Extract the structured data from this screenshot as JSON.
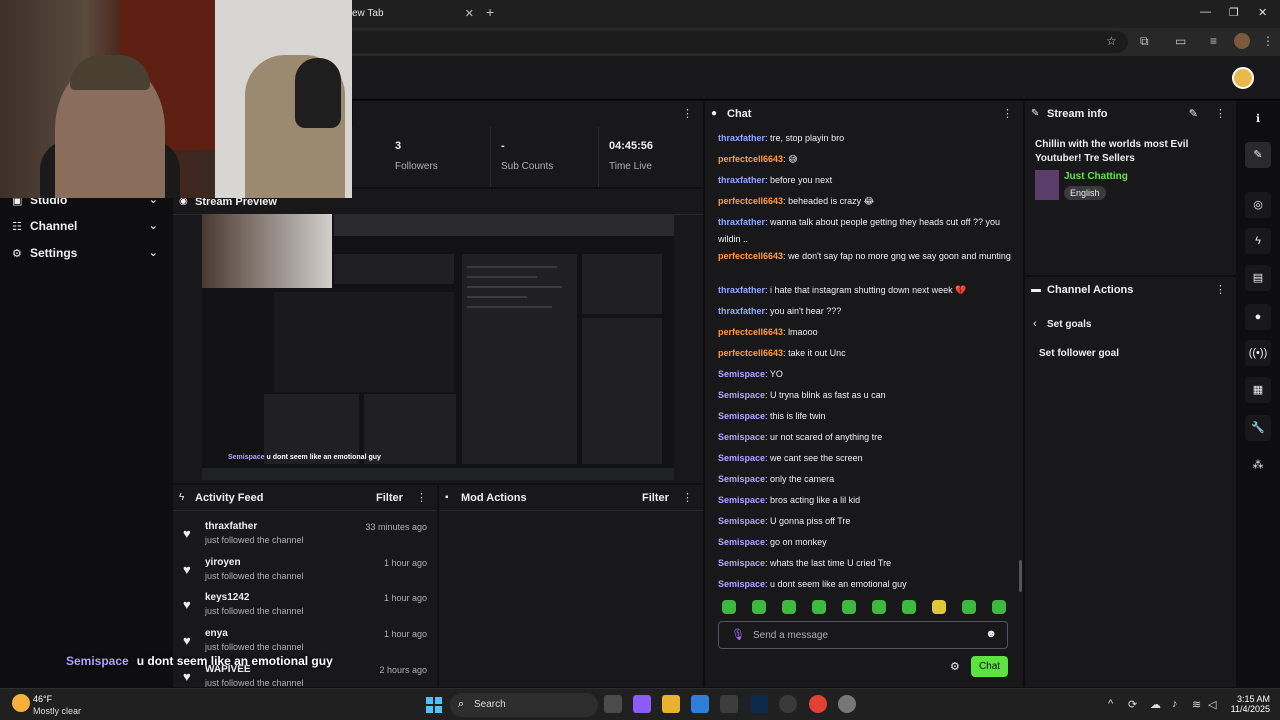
{
  "browser": {
    "tab_title": "ew Tab",
    "new_tab_symbol": "+"
  },
  "left_nav": {
    "items": [
      {
        "label": "Studio",
        "icon": "broadcast-icon"
      },
      {
        "label": "Channel",
        "icon": "channel-icon"
      },
      {
        "label": "Settings",
        "icon": "gear-icon"
      }
    ]
  },
  "stats": [
    {
      "value": "3",
      "label": "Followers"
    },
    {
      "value": "-",
      "label": "Sub Counts"
    },
    {
      "value": "04:45:56",
      "label": "Time Live"
    }
  ],
  "stream_preview": {
    "title": "Stream Preview",
    "caption_user": "Semispace",
    "caption_text": "u dont seem like an emotional guy"
  },
  "activity_feed": {
    "title": "Activity Feed",
    "filter_label": "Filter",
    "items": [
      {
        "name": "thraxfather",
        "sub": "just followed the channel",
        "time": "33 minutes ago"
      },
      {
        "name": "yiroyen",
        "sub": "just followed the channel",
        "time": "1 hour ago"
      },
      {
        "name": "keys1242",
        "sub": "just followed the channel",
        "time": "1 hour ago"
      },
      {
        "name": "enya",
        "sub": "just followed the channel",
        "time": "1 hour ago"
      },
      {
        "name": "WAPIVEE",
        "sub": "just followed the channel",
        "time": "2 hours ago"
      }
    ]
  },
  "mod_actions": {
    "title": "Mod Actions",
    "filter_label": "Filter"
  },
  "chat": {
    "title": "Chat",
    "placeholder": "Send a message",
    "send_label": "Chat",
    "colors": {
      "thraxfather": "#8fa8ff",
      "perfectcell6643": "#ff9a3c",
      "Semispace": "#b4a0ff"
    },
    "messages": [
      {
        "user": "thraxfather",
        "text": "tre, stop playin bro"
      },
      {
        "user": "perfectcell6643",
        "text": "😅"
      },
      {
        "user": "thraxfather",
        "text": "before you next"
      },
      {
        "user": "perfectcell6643",
        "text": "beheaded is crazy 😂"
      },
      {
        "user": "thraxfather",
        "text": "wanna talk about people getting they heads cut off ?? you wildin .."
      },
      {
        "user": "perfectcell6643",
        "text": "we don't say fap no more gng we say goon and munting"
      },
      {
        "user": "thraxfather",
        "text": "i hate that instagram shutting down next week 💔"
      },
      {
        "user": "thraxfather",
        "text": "you ain't hear ???"
      },
      {
        "user": "perfectcell6643",
        "text": "lmaooo"
      },
      {
        "user": "perfectcell6643",
        "text": "take it out Unc"
      },
      {
        "user": "Semispace",
        "text": "YO"
      },
      {
        "user": "Semispace",
        "text": "U tryna blink as fast as u can"
      },
      {
        "user": "Semispace",
        "text": "this is life twin"
      },
      {
        "user": "Semispace",
        "text": "ur not scared of anything tre"
      },
      {
        "user": "Semispace",
        "text": "we cant see the screen"
      },
      {
        "user": "Semispace",
        "text": "only the camera"
      },
      {
        "user": "Semispace",
        "text": "bros acting like a lil kid"
      },
      {
        "user": "Semispace",
        "text": "U gonna piss off Tre"
      },
      {
        "user": "Semispace",
        "text": "go on monkey"
      },
      {
        "user": "Semispace",
        "text": "whats the last time U cried Tre"
      },
      {
        "user": "Semispace",
        "text": "u dont seem like an emotional guy"
      }
    ]
  },
  "stream_info": {
    "title": "Stream info",
    "stream_title": "Chillin with the worlds most Evil Youtuber! Tre Sellers",
    "category": "Just Chatting",
    "tag": "English"
  },
  "channel_actions": {
    "title": "Channel Actions",
    "back_label": "Set goals",
    "item": "Set follower goal"
  },
  "overlay_caption": {
    "user": "Semispace",
    "text": "u dont seem like an emotional guy"
  },
  "taskbar": {
    "temp": "46°F",
    "weather": "Mostly clear",
    "search_label": "Search",
    "time": "3:15 AM",
    "date": "11/4/2025"
  }
}
